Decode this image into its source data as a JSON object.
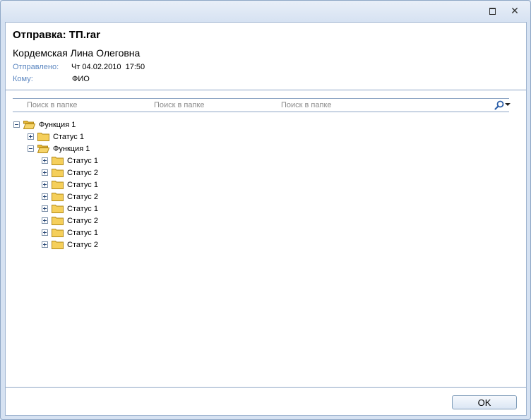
{
  "window": {
    "maximize_icon": "maximize-icon",
    "close_glyph": "✕"
  },
  "message": {
    "title": "Отправка: ТП.rar",
    "sender": "Кордемская Лина Олеговна",
    "sent_label": "Отправлено:",
    "sent_value": "Чт 04.02.2010  17:50",
    "to_label": "Кому:",
    "to_value": "ФИО"
  },
  "search": {
    "placeholders": [
      "Поиск в папке",
      "Поиск в папке",
      "Поиск в папке"
    ],
    "icon": "search-icon"
  },
  "tree": {
    "root": "Функция 1",
    "status1": "Статус 1",
    "sub": "Функция 1",
    "children": [
      "Статус 1",
      "Статус 2",
      "Статус 1",
      "Статус 2",
      "Статус 1",
      "Статус 2",
      "Статус 1",
      "Статус 2"
    ]
  },
  "footer": {
    "ok_label": "OK"
  },
  "colors": {
    "label_blue": "#5b86c0",
    "folder_yellow": "#f5cf5b",
    "border_blue": "#8ca4c4"
  }
}
